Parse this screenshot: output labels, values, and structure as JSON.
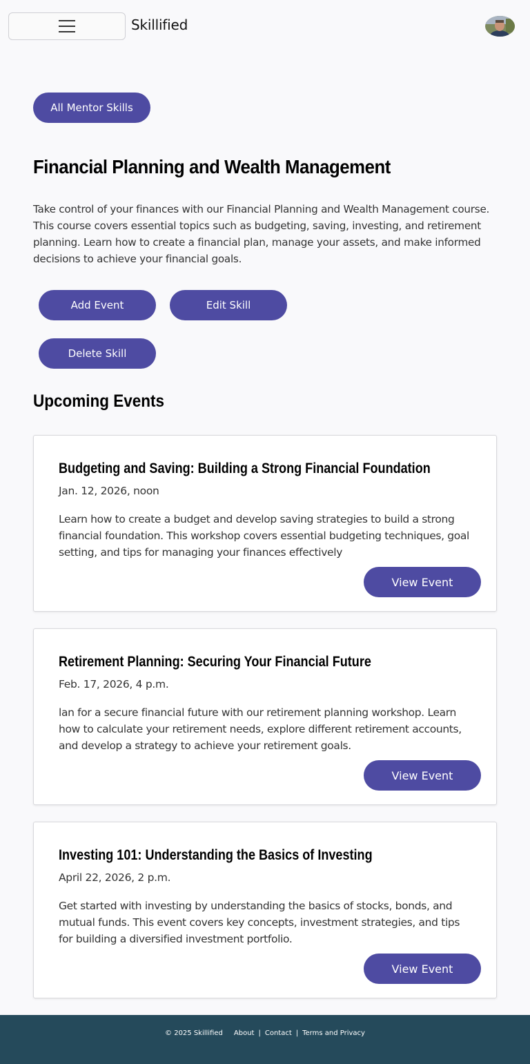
{
  "header": {
    "brand": "Skillified"
  },
  "nav": {
    "all_skills_label": "All Mentor Skills"
  },
  "skill": {
    "title": "Financial Planning and Wealth Management",
    "description": "Take control of your finances with our Financial Planning and Wealth Management course. This course covers essential topics such as budgeting, saving, investing, and retirement planning. Learn how to create a financial plan, manage your assets, and make informed decisions to achieve your financial goals.",
    "actions": {
      "add_event": "Add Event",
      "edit_skill": "Edit Skill",
      "delete_skill": "Delete Skill"
    }
  },
  "events": {
    "heading": "Upcoming Events",
    "items": [
      {
        "title": "Budgeting and Saving: Building a Strong Financial Foundation",
        "date": "Jan. 12, 2026, noon",
        "description": "Learn how to create a budget and develop saving strategies to build a strong financial foundation. This workshop covers essential budgeting techniques, goal setting, and tips for managing your finances effectively",
        "button": "View Event"
      },
      {
        "title": "Retirement Planning: Securing Your Financial Future",
        "date": "Feb. 17, 2026, 4 p.m.",
        "description": "lan for a secure financial future with our retirement planning workshop. Learn how to calculate your retirement needs, explore different retirement accounts, and develop a strategy to achieve your retirement goals.",
        "button": "View Event"
      },
      {
        "title": "Investing 101: Understanding the Basics of Investing",
        "date": "April 22, 2026, 2 p.m.",
        "description": "Get started with investing by understanding the basics of stocks, bonds, and mutual funds. This event covers key concepts, investment strategies, and tips for building a diversified investment portfolio.",
        "button": "View Event"
      }
    ]
  },
  "footer": {
    "copyright": "© 2025 Skillified",
    "about": "About",
    "contact": "Contact",
    "terms": "Terms and Privacy",
    "separator": "|"
  },
  "colors": {
    "accent": "#4e4ba2",
    "footer_bg": "#254a5b",
    "page_bg": "#f9f9fb"
  },
  "icons": {
    "menu": "hamburger-menu-icon",
    "avatar": "user-avatar-photo"
  }
}
